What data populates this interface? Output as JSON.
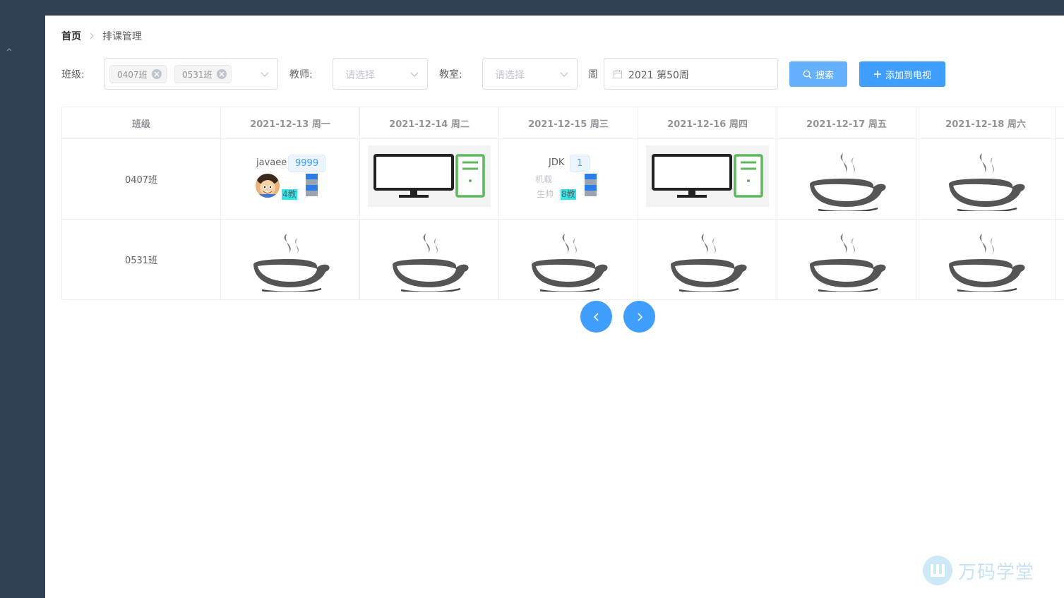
{
  "breadcrumb": {
    "home": "首页",
    "current": "排课管理"
  },
  "filters": {
    "class_label": "班级:",
    "class_tags": [
      "0407班",
      "0531班"
    ],
    "teacher_label": "教师:",
    "teacher_placeholder": "请选择",
    "room_label": "教室:",
    "room_placeholder": "请选择",
    "week_label": "周",
    "week_value": "2021 第50周",
    "search_label": "搜索",
    "add_label": "添加到电视"
  },
  "schedule": {
    "corner_header": "班级",
    "days": [
      "2021-12-13 周一",
      "2021-12-14 周二",
      "2021-12-15 周三",
      "2021-12-16 周四",
      "2021-12-17 周五",
      "2021-12-18 周六"
    ],
    "rows": [
      {
        "class_name": "0407班",
        "cells": [
          {
            "type": "course",
            "name": "javaee",
            "badge": "9999",
            "teacher_count": "4教"
          },
          {
            "type": "computer"
          },
          {
            "type": "course",
            "name": "JDK",
            "badge": "1",
            "teacher_count": "8教",
            "faint_line1": "机载",
            "faint_line2": "生帅"
          },
          {
            "type": "computer"
          },
          {
            "type": "empty"
          },
          {
            "type": "empty"
          }
        ]
      },
      {
        "class_name": "0531班",
        "cells": [
          {
            "type": "empty"
          },
          {
            "type": "empty"
          },
          {
            "type": "empty"
          },
          {
            "type": "empty"
          },
          {
            "type": "empty"
          },
          {
            "type": "empty"
          }
        ]
      }
    ]
  },
  "watermark": {
    "text": "万码学堂"
  },
  "icons": {
    "sidebar_toggle": "chevron-up-icon",
    "breadcrumb_sep": "chevron-right-icon",
    "select_arrow": "chevron-down-icon",
    "tag_close": "close-circle-icon",
    "week_icon": "calendar-icon",
    "search_icon": "search-icon",
    "add_icon": "plus-icon",
    "prev": "chevron-left-icon",
    "next": "chevron-right-icon",
    "empty_slot": "coffee-cup-icon",
    "computer": "computer-icon"
  },
  "colors": {
    "sidebar": "#304156",
    "primary": "#409eff",
    "primary_light": "#66b1ff",
    "teacher_highlight": "#2ee6e6"
  }
}
